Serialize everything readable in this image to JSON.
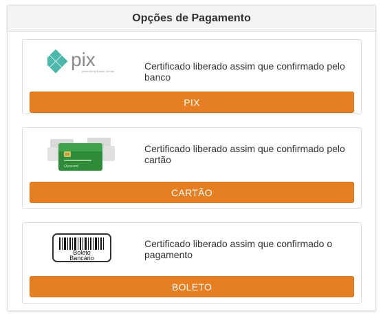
{
  "header": {
    "title": "Opções de Pagamento"
  },
  "options": [
    {
      "id": "pix",
      "logo_icon": "pix-logo",
      "logo_text": "pix",
      "logo_subtext": "powered by Banco Central",
      "description": "Certificado liberado assim que confirmado pelo banco",
      "button_label": "PIX"
    },
    {
      "id": "cartao",
      "logo_icon": "credit-card-icon",
      "description": "Certificado liberado assim que confirmado pelo cartão",
      "button_label": "CARTÃO"
    },
    {
      "id": "boleto",
      "logo_icon": "barcode-icon",
      "logo_text_line1": "Boleto",
      "logo_text_line2": "Bancário",
      "description": "Certificado liberado assim que confirmado o pagamento",
      "button_label": "BOLETO"
    }
  ],
  "colors": {
    "button_bg": "#e67e22",
    "pix_teal": "#4bb8a9",
    "card_green": "#2e8b3a"
  }
}
